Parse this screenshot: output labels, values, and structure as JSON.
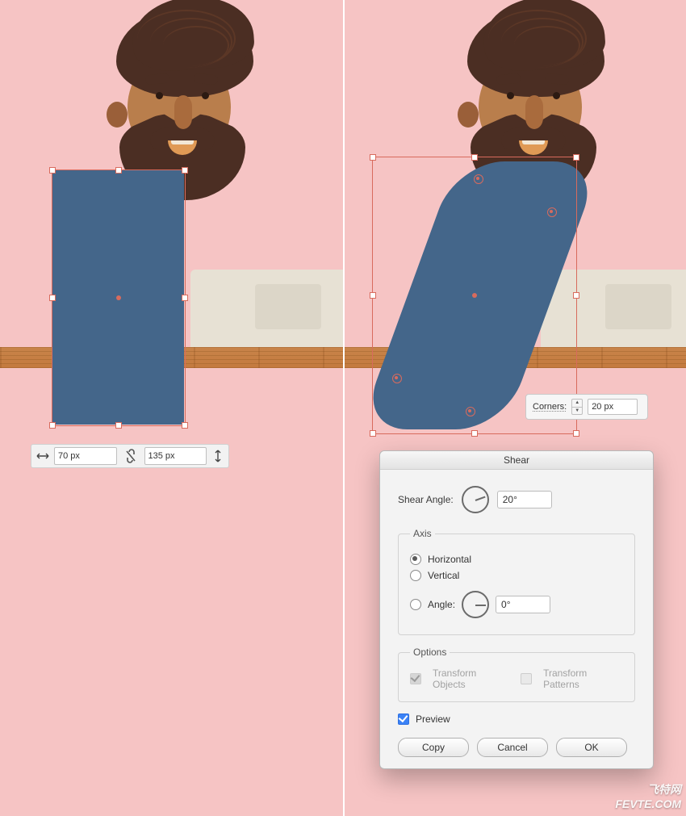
{
  "watermark": {
    "line1": "飞特网",
    "line2": "FEVTE.COM"
  },
  "transform_bar": {
    "width_value": "70 px",
    "height_value": "135 px"
  },
  "corners_popup": {
    "label": "Corners:",
    "value": "20 px"
  },
  "shear_dialog": {
    "title": "Shear",
    "angle_label": "Shear Angle:",
    "angle_value": "20°",
    "axis": {
      "legend": "Axis",
      "horizontal": "Horizontal",
      "vertical": "Vertical",
      "angle_label": "Angle:",
      "angle_value": "0°",
      "selected": "horizontal"
    },
    "options": {
      "legend": "Options",
      "transform_objects": "Transform Objects",
      "transform_patterns": "Transform Patterns",
      "transform_objects_checked": true,
      "transform_patterns_checked": false,
      "disabled": true
    },
    "preview": {
      "label": "Preview",
      "checked": true
    },
    "buttons": {
      "copy": "Copy",
      "cancel": "Cancel",
      "ok": "OK"
    }
  }
}
